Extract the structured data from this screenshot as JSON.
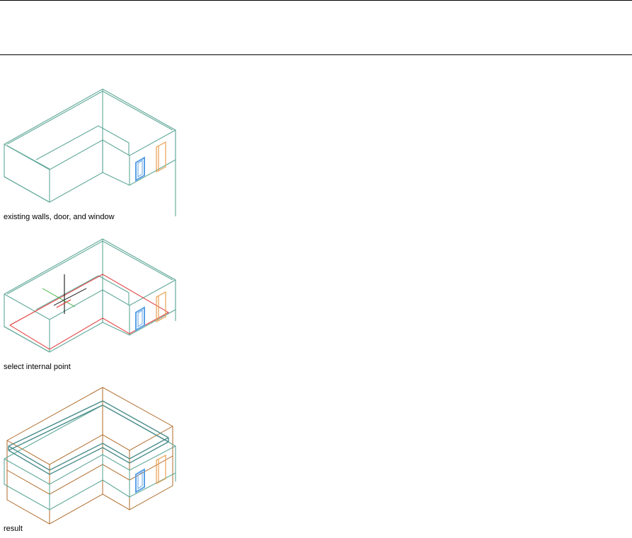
{
  "figures": [
    {
      "caption": "existing walls, door, and window",
      "elements": [
        "walls",
        "door",
        "window"
      ]
    },
    {
      "caption": "select internal point",
      "elements": [
        "walls",
        "door",
        "window",
        "boundary-outline",
        "cursor-crosshair"
      ]
    },
    {
      "caption": "result",
      "elements": [
        "walls",
        "door",
        "window",
        "slab-outline",
        "roof-slab"
      ]
    }
  ],
  "colors": {
    "wall": "#5fa898",
    "window": "#5aa0e6",
    "door": "#e8a050",
    "boundary": "#e03030",
    "slab": "#b06a2a",
    "rule": "#000000"
  }
}
